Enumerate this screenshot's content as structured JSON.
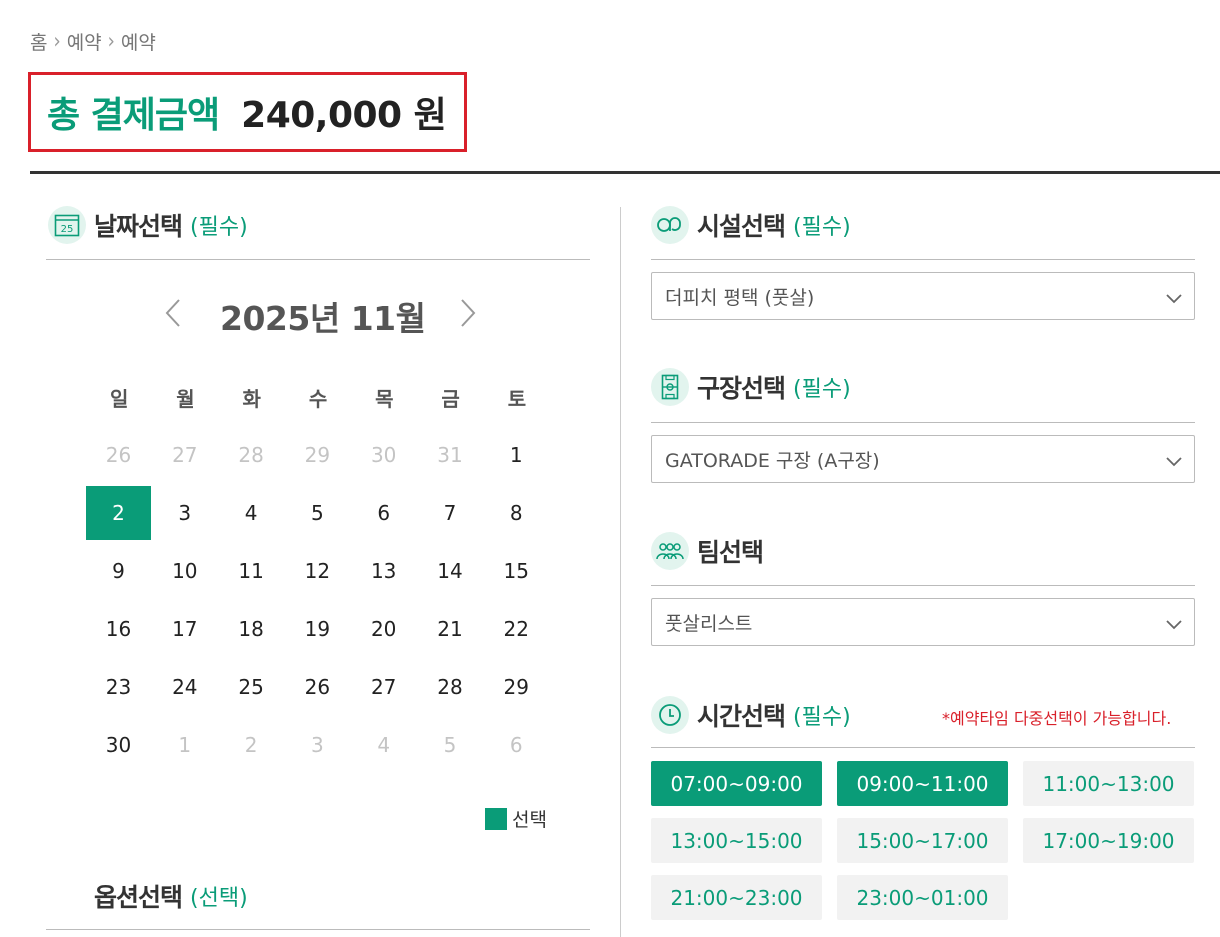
{
  "breadcrumb": [
    "홈",
    "예약",
    "예약"
  ],
  "total": {
    "label": "총 결제금액",
    "amount": "240,000 원"
  },
  "date_section": {
    "title": "날짜선택",
    "req": "(필수)",
    "icon_text": "25"
  },
  "calendar": {
    "month_label": "2025년  11월",
    "weekdays": [
      "일",
      "월",
      "화",
      "수",
      "목",
      "금",
      "토"
    ],
    "days": [
      {
        "d": "26",
        "muted": true
      },
      {
        "d": "27",
        "muted": true
      },
      {
        "d": "28",
        "muted": true
      },
      {
        "d": "29",
        "muted": true
      },
      {
        "d": "30",
        "muted": true
      },
      {
        "d": "31",
        "muted": true
      },
      {
        "d": "1"
      },
      {
        "d": "2",
        "selected": true
      },
      {
        "d": "3"
      },
      {
        "d": "4"
      },
      {
        "d": "5"
      },
      {
        "d": "6"
      },
      {
        "d": "7"
      },
      {
        "d": "8"
      },
      {
        "d": "9"
      },
      {
        "d": "10"
      },
      {
        "d": "11"
      },
      {
        "d": "12"
      },
      {
        "d": "13"
      },
      {
        "d": "14"
      },
      {
        "d": "15"
      },
      {
        "d": "16"
      },
      {
        "d": "17"
      },
      {
        "d": "18"
      },
      {
        "d": "19"
      },
      {
        "d": "20"
      },
      {
        "d": "21"
      },
      {
        "d": "22"
      },
      {
        "d": "23"
      },
      {
        "d": "24"
      },
      {
        "d": "25"
      },
      {
        "d": "26"
      },
      {
        "d": "27"
      },
      {
        "d": "28"
      },
      {
        "d": "29"
      },
      {
        "d": "30"
      },
      {
        "d": "1",
        "muted": true
      },
      {
        "d": "2",
        "muted": true
      },
      {
        "d": "3",
        "muted": true
      },
      {
        "d": "4",
        "muted": true
      },
      {
        "d": "5",
        "muted": true
      },
      {
        "d": "6",
        "muted": true
      }
    ],
    "legend_label": "선택"
  },
  "option_section": {
    "title": "옵션선택",
    "req": "(선택)"
  },
  "facility_section": {
    "title": "시설선택",
    "req": "(필수)",
    "value": "더피치 평택 (풋살)"
  },
  "field_section": {
    "title": "구장선택",
    "req": "(필수)",
    "value": "GATORADE 구장 (A구장)"
  },
  "team_section": {
    "title": "팀선택",
    "value": "풋살리스트"
  },
  "time_section": {
    "title": "시간선택",
    "req": "(필수)",
    "note": "*예약타임 다중선택이 가능합니다.",
    "slots": [
      {
        "label": "07:00~09:00",
        "selected": true
      },
      {
        "label": "09:00~11:00",
        "selected": true
      },
      {
        "label": "11:00~13:00"
      },
      {
        "label": "13:00~15:00"
      },
      {
        "label": "15:00~17:00"
      },
      {
        "label": "17:00~19:00"
      },
      {
        "label": "21:00~23:00"
      },
      {
        "label": "23:00~01:00"
      }
    ]
  },
  "colors": {
    "accent": "#0a9c78",
    "highlight_border": "#d9202a",
    "note": "#d9202a"
  }
}
